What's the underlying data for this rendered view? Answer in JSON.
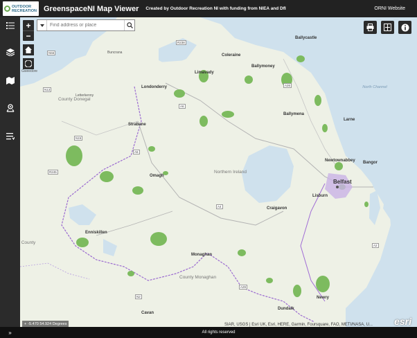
{
  "header": {
    "logo_text_1": "OUTDOOR",
    "logo_text_2": "RECREATION",
    "title": "GreenspaceNI Map Viewer",
    "subtitle": "Created by Outdoor Recreation NI with funding from NIEA and DfI",
    "link": "ORNI Website"
  },
  "sidebar": {
    "items": [
      {
        "icon": "list-icon"
      },
      {
        "icon": "layers-icon"
      },
      {
        "icon": "basemap-icon"
      },
      {
        "icon": "share-icon"
      },
      {
        "icon": "details-icon"
      }
    ],
    "collapse_label": "»"
  },
  "controls": {
    "zoom_in": "+",
    "zoom_out": "−",
    "search_placeholder": "Find address or place"
  },
  "map_labels": {
    "places": [
      "Buncrana",
      "Gweedore",
      "Coleraine",
      "Ballymoney",
      "Limavady",
      "Londonderry",
      "Letterkenny",
      "Ballymena",
      "Larne",
      "Strabane",
      "Newtownabbey",
      "Bangor",
      "Belfast",
      "Omagh",
      "Lisburn",
      "Craigavon",
      "Enniskillen",
      "Monaghan",
      "Newry",
      "Cavan",
      "Dundalk",
      "Ballycastle"
    ],
    "regions": {
      "donegal": "County Donegal",
      "ni": "Northern Ireland",
      "monaghan": "County Monaghan",
      "county_left": "County"
    },
    "sea": "North Channel",
    "roads": [
      "N56",
      "R238",
      "N13",
      "N15",
      "A6",
      "A5",
      "A4",
      "A29",
      "A2",
      "N2",
      "R245",
      "A26"
    ]
  },
  "status": {
    "coordinates": "-5.470 54.924 Degrees",
    "attribution": "SIAR, USGS | Esri UK, Esri, HERE, Garmin, Foursquare, FAO, METI/NASA, U...",
    "rights": "All rights reserved",
    "esri": "esri"
  },
  "colors": {
    "header_bg": "#222222",
    "land": "#eef1e6",
    "water": "#cfe1ed",
    "greenspace": "#7dbb5f",
    "boundary": "#9b6bd0"
  }
}
